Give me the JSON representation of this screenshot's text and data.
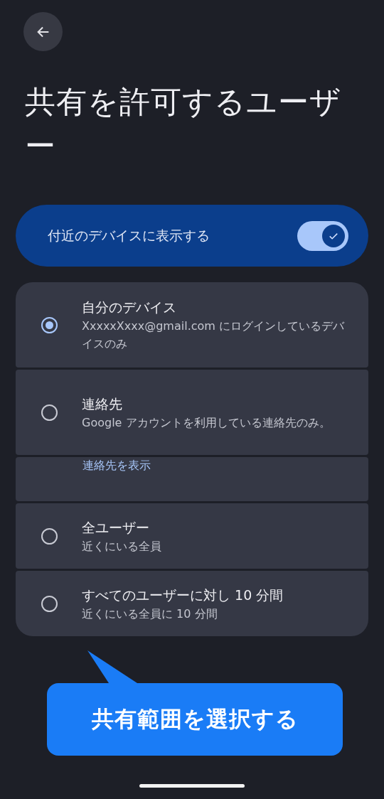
{
  "title": "共有を許可するユーザー",
  "visibility": {
    "label": "付近のデバイスに表示する",
    "on": true
  },
  "options": [
    {
      "title": "自分のデバイス",
      "subtitle": "XxxxxXxxx@gmail.com にログインしているデバイスのみ",
      "selected": true
    },
    {
      "title": "連絡先",
      "subtitle": "Google アカウントを利用している連絡先のみ。",
      "selected": false,
      "link": "連絡先を表示"
    },
    {
      "title": "全ユーザー",
      "subtitle": "近くにいる全員",
      "selected": false
    },
    {
      "title": "すべてのユーザーに対し 10 分間",
      "subtitle": "近くにいる全員に 10 分間",
      "selected": false
    }
  ],
  "callout": "共有範囲を選択する"
}
